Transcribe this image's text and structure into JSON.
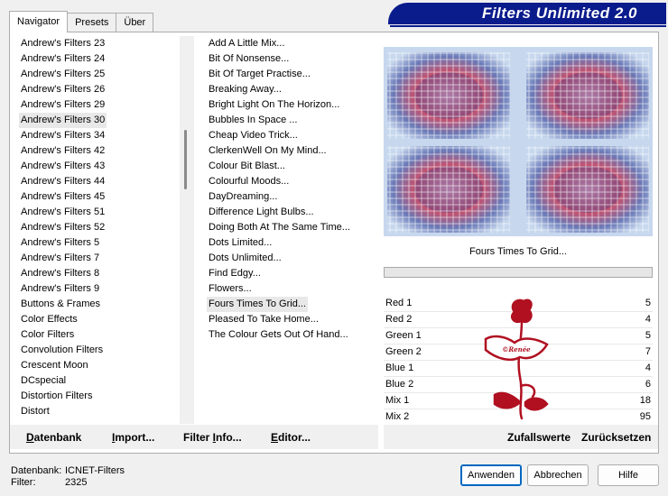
{
  "tabs": [
    "Navigator",
    "Presets",
    "Über"
  ],
  "active_tab": 0,
  "app_title": "Filters Unlimited 2.0",
  "categories": [
    "Andrew's Filters 23",
    "Andrew's Filters 24",
    "Andrew's Filters 25",
    "Andrew's Filters 26",
    "Andrew's Filters 29",
    "Andrew's Filters 30",
    "Andrew's Filters 34",
    "Andrew's Filters 42",
    "Andrew's Filters 43",
    "Andrew's Filters 44",
    "Andrew's Filters 45",
    "Andrew's Filters 51",
    "Andrew's Filters 52",
    "Andrew's Filters 5",
    "Andrew's Filters 7",
    "Andrew's Filters 8",
    "Andrew's Filters 9",
    "Buttons & Frames",
    "Color Effects",
    "Color Filters",
    "Convolution Filters",
    "Crescent Moon",
    "DCspecial",
    "Distortion Filters",
    "Distort"
  ],
  "selected_category": 5,
  "filters": [
    "Add A Little Mix...",
    "Bit Of Nonsense...",
    "Bit Of Target Practise...",
    "Breaking Away...",
    "Bright Light On The Horizon...",
    "Bubbles In Space ...",
    "Cheap Video Trick...",
    "ClerkenWell On My Mind...",
    "Colour Bit Blast...",
    "Colourful Moods...",
    "DayDreaming...",
    "Difference Light Bulbs...",
    "Doing Both At The Same Time...",
    "Dots Limited...",
    "Dots Unlimited...",
    "Find Edgy...",
    "Flowers...",
    "Fours Times To Grid...",
    "Pleased To Take Home...",
    "The Colour Gets Out Of Hand..."
  ],
  "selected_filter": 17,
  "bottom_buttons": {
    "database": {
      "hot": "D",
      "rest": "atenbank"
    },
    "import": {
      "hot": "I",
      "rest": "mport..."
    },
    "filter_info": {
      "pre": "Filter ",
      "hot": "I",
      "rest": "nfo..."
    },
    "editor": {
      "hot": "E",
      "rest": "ditor..."
    }
  },
  "preview_filter_name": "Fours Times To Grid...",
  "params": [
    {
      "label": "Red 1",
      "value": "5"
    },
    {
      "label": "Red 2",
      "value": "4"
    },
    {
      "label": "Green 1",
      "value": "5"
    },
    {
      "label": "Green 2",
      "value": "7"
    },
    {
      "label": "Blue 1",
      "value": "4"
    },
    {
      "label": "Blue 2",
      "value": "6"
    },
    {
      "label": "Mix 1",
      "value": "18"
    },
    {
      "label": "Mix 2",
      "value": "95"
    }
  ],
  "random_label": "Zufallswerte",
  "reset_label": "Zurücksetzen",
  "status": {
    "db_key": "Datenbank:",
    "db_value": "ICNET-Filters",
    "filter_key": "Filter:",
    "filter_value": "2325"
  },
  "dialog_buttons": {
    "apply": "Anwenden",
    "cancel": "Abbrechen",
    "help": "Hilfe"
  },
  "colors": {
    "banner": "#0a1b8c",
    "preview_bg": "#c7d8ee",
    "watermark": "#b01020"
  }
}
